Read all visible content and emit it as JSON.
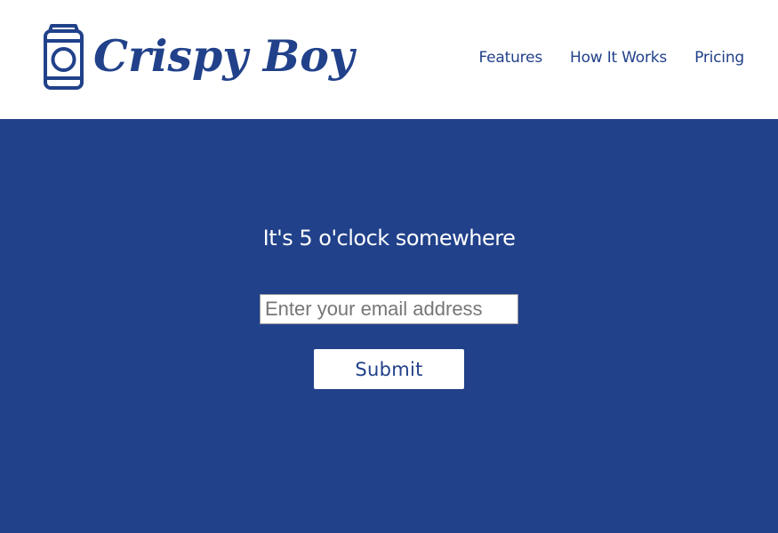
{
  "brand": {
    "name": "Crispy Boy",
    "icon": "soda-can-icon",
    "color": "#21418a"
  },
  "nav": {
    "items": [
      {
        "label": "Features"
      },
      {
        "label": "How It Works"
      },
      {
        "label": "Pricing"
      }
    ]
  },
  "hero": {
    "title": "It's 5 o'clock somewhere",
    "background_color": "#21418a",
    "email": {
      "value": "",
      "placeholder": "Enter your email address"
    },
    "submit_label": "Submit"
  }
}
